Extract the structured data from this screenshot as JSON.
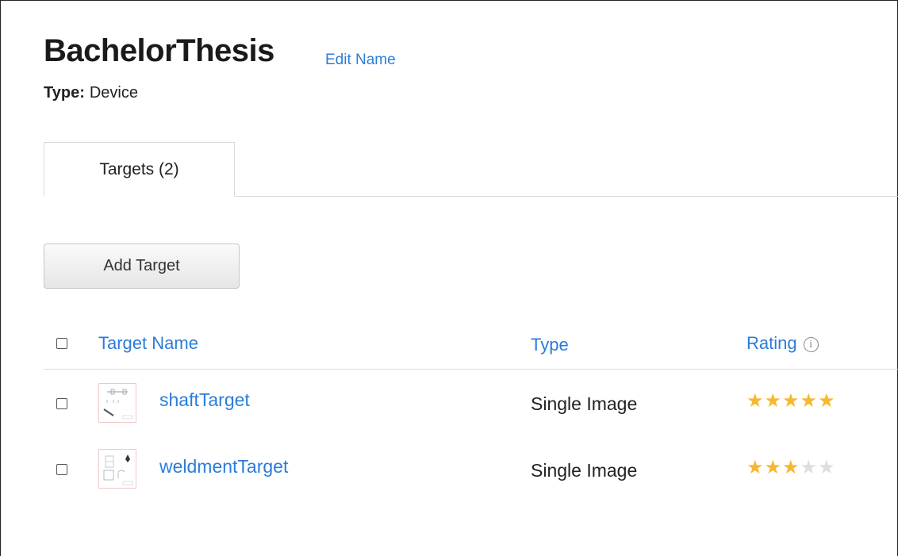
{
  "database": {
    "name": "BachelorThesis",
    "edit_label": "Edit Name",
    "type_label": "Type:",
    "type_value": "Device"
  },
  "tabs": [
    {
      "label": "Targets (2)",
      "active": true
    }
  ],
  "toolbar": {
    "add_target_label": "Add Target"
  },
  "table": {
    "columns": {
      "name": "Target Name",
      "type": "Type",
      "rating": "Rating",
      "rating_info_icon": "info-icon"
    },
    "rows": [
      {
        "name": "shaftTarget",
        "type": "Single Image",
        "rating": 5,
        "rating_max": 5,
        "thumbnail_icon": "target-thumbnail-icon"
      },
      {
        "name": "weldmentTarget",
        "type": "Single Image",
        "rating": 3,
        "rating_max": 5,
        "thumbnail_icon": "target-thumbnail-icon"
      }
    ]
  },
  "colors": {
    "link": "#2b7cd9",
    "star_filled": "#f5b82e",
    "star_empty": "#dedede"
  }
}
